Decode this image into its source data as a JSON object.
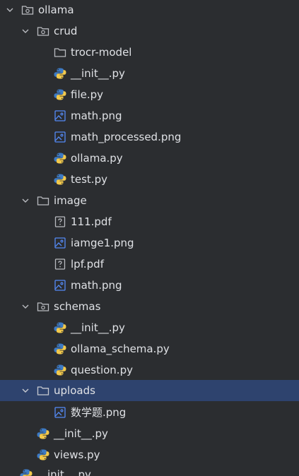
{
  "project_tree": {
    "items": [
      {
        "label": "ollama",
        "kind": "package",
        "icon": "package-folder-icon",
        "expanded": true
      },
      {
        "label": "crud",
        "kind": "package",
        "icon": "package-folder-icon",
        "expanded": true
      },
      {
        "label": "trocr-model",
        "kind": "folder",
        "icon": "folder-icon",
        "expanded": false
      },
      {
        "label": "__init__.py",
        "kind": "python",
        "icon": "python-file-icon"
      },
      {
        "label": "file.py",
        "kind": "python",
        "icon": "python-file-icon"
      },
      {
        "label": "math.png",
        "kind": "image",
        "icon": "image-file-icon"
      },
      {
        "label": "math_processed.png",
        "kind": "image",
        "icon": "image-file-icon"
      },
      {
        "label": "ollama.py",
        "kind": "python",
        "icon": "python-file-icon"
      },
      {
        "label": "test.py",
        "kind": "python",
        "icon": "python-file-icon"
      },
      {
        "label": "image",
        "kind": "folder",
        "icon": "folder-icon",
        "expanded": true
      },
      {
        "label": "111.pdf",
        "kind": "unknown",
        "icon": "unknown-file-icon"
      },
      {
        "label": "iamge1.png",
        "kind": "image",
        "icon": "image-file-icon"
      },
      {
        "label": "lpf.pdf",
        "kind": "unknown",
        "icon": "unknown-file-icon"
      },
      {
        "label": "math.png",
        "kind": "image",
        "icon": "image-file-icon"
      },
      {
        "label": "schemas",
        "kind": "package",
        "icon": "package-folder-icon",
        "expanded": true
      },
      {
        "label": "__init__.py",
        "kind": "python",
        "icon": "python-file-icon"
      },
      {
        "label": "ollama_schema.py",
        "kind": "python",
        "icon": "python-file-icon"
      },
      {
        "label": "question.py",
        "kind": "python",
        "icon": "python-file-icon"
      },
      {
        "label": "uploads",
        "kind": "folder",
        "icon": "folder-icon",
        "expanded": true,
        "selected": true
      },
      {
        "label": "数学题.png",
        "kind": "image",
        "icon": "image-file-icon"
      },
      {
        "label": "__init__.py",
        "kind": "python",
        "icon": "python-file-icon"
      },
      {
        "label": "views.py",
        "kind": "python",
        "icon": "python-file-icon"
      },
      {
        "label": "__init__.py",
        "kind": "python",
        "icon": "python-file-icon"
      }
    ]
  },
  "colors": {
    "background": "#2b2d30",
    "selection": "#2e436e",
    "text": "#dfe1e5",
    "icon_gray": "#b9bbc0",
    "image_blue": "#548af7",
    "python_blue": "#3d7ac4",
    "python_yellow": "#f2c94c"
  }
}
